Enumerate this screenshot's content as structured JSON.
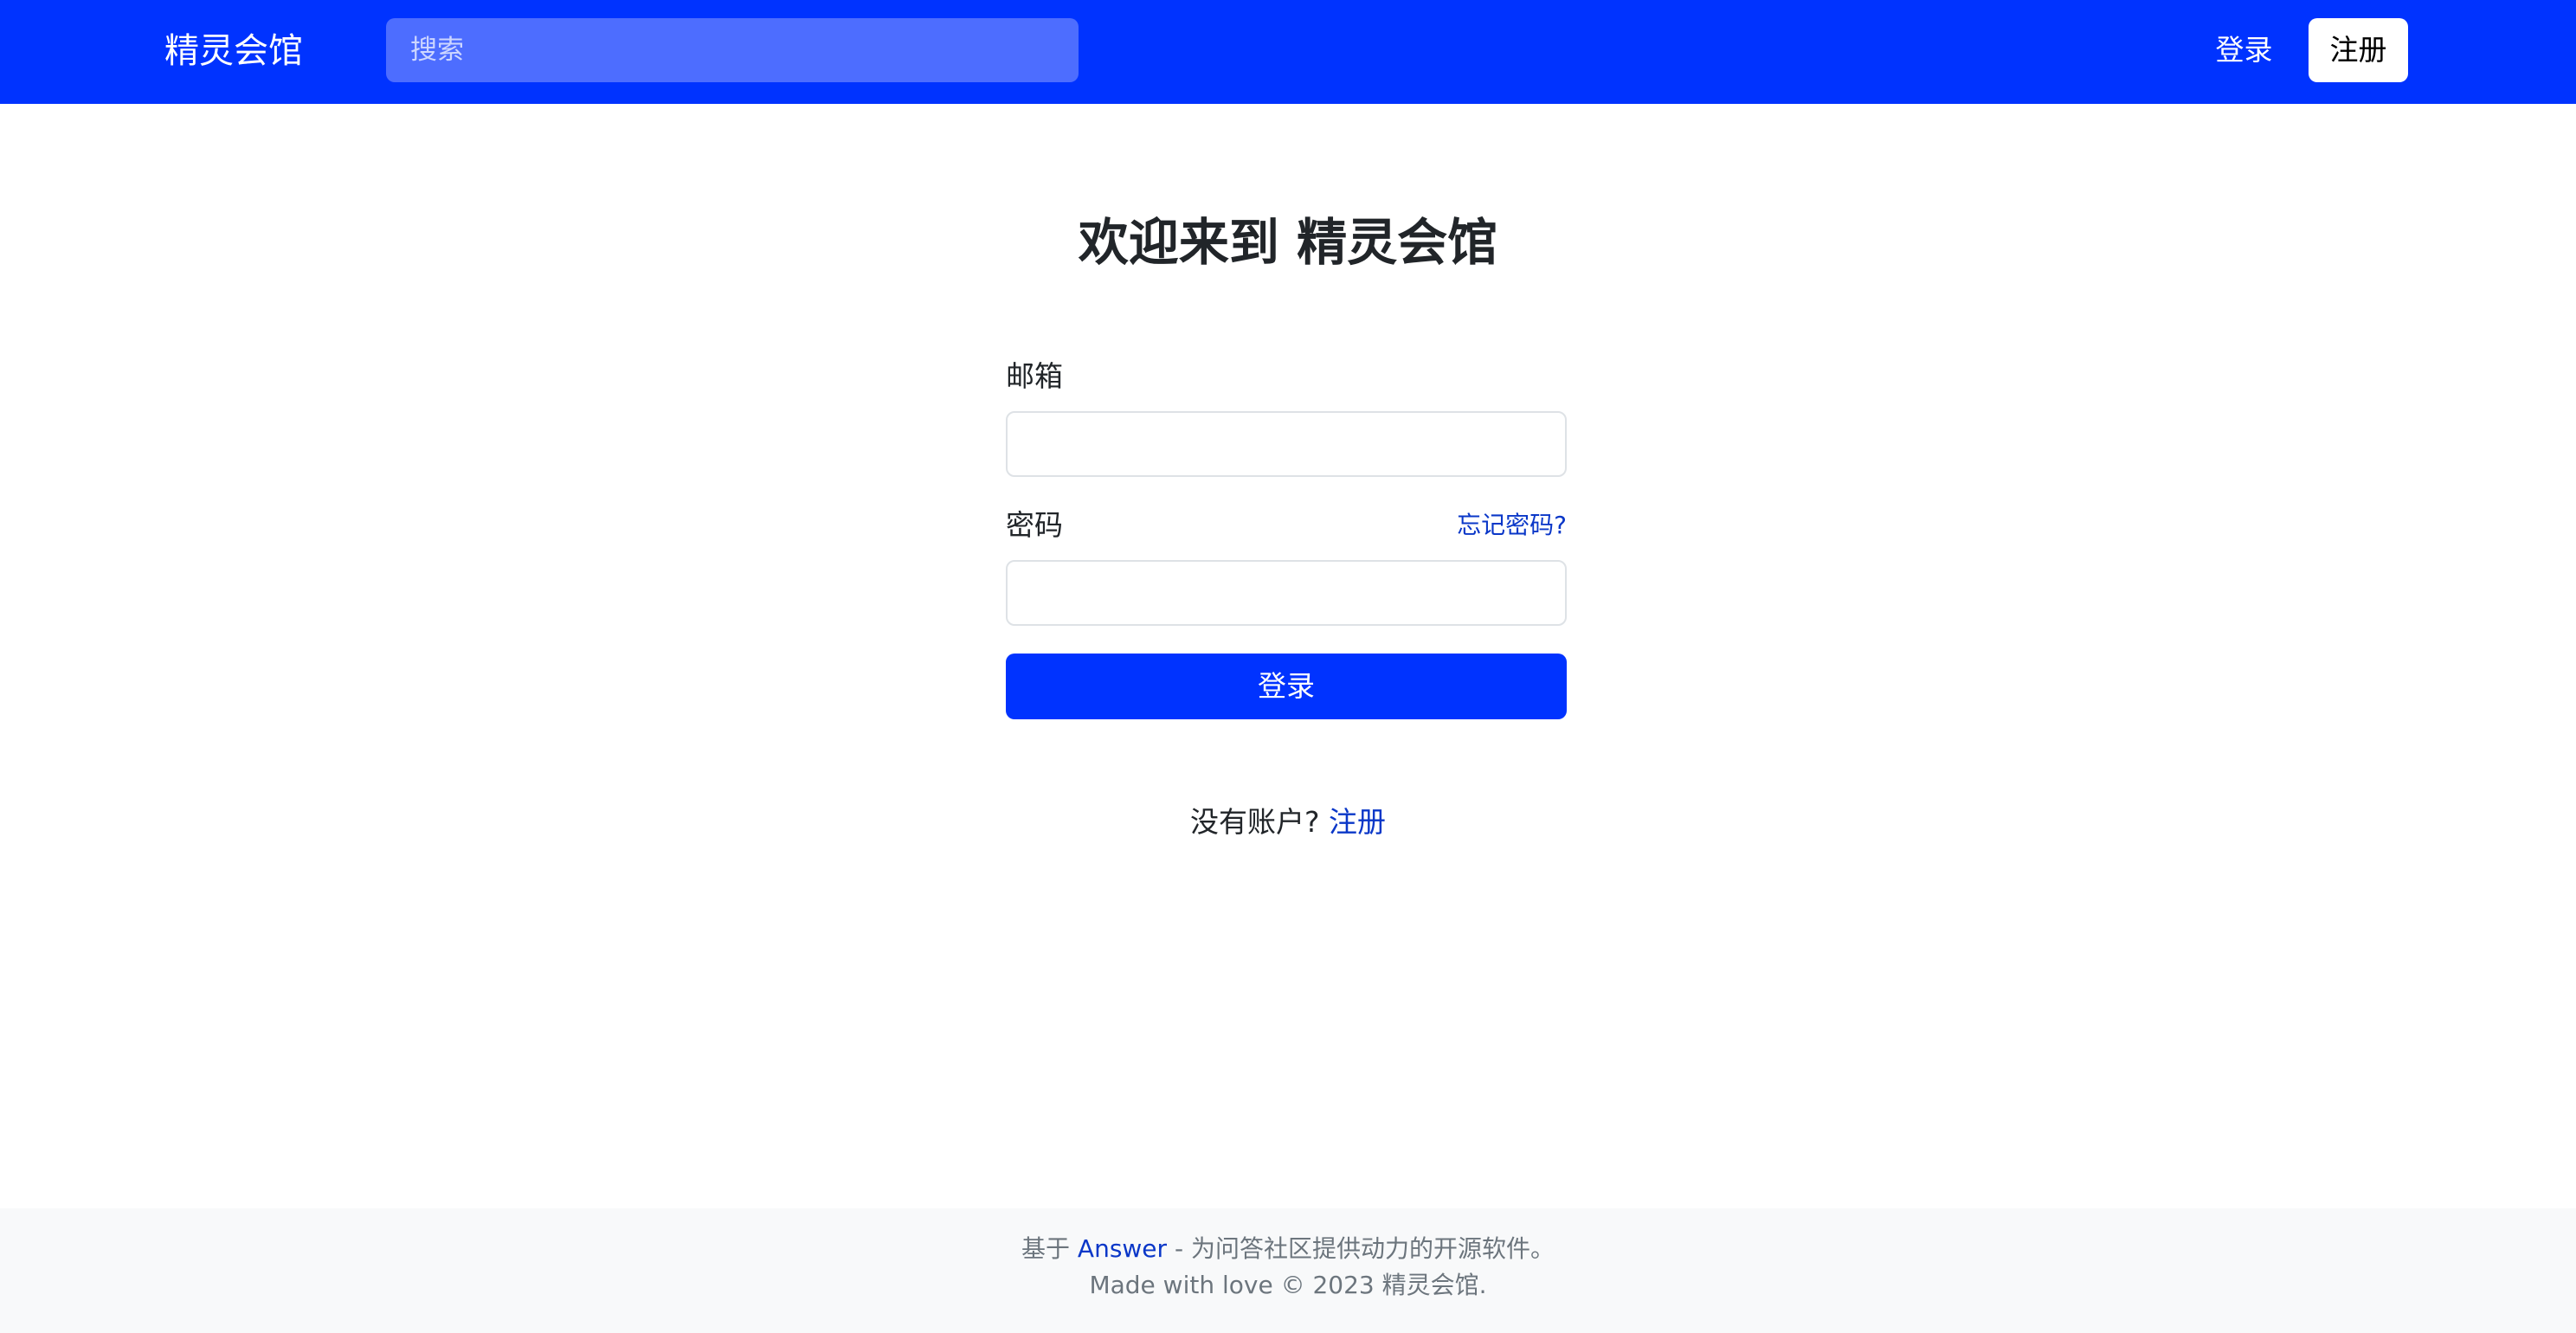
{
  "header": {
    "brand": "精灵会馆",
    "search_placeholder": "搜索",
    "login_label": "登录",
    "signup_label": "注册"
  },
  "main": {
    "title": "欢迎来到 精灵会馆",
    "email_label": "邮箱",
    "password_label": "密码",
    "forgot_label": "忘记密码?",
    "submit_label": "登录",
    "no_account_text": "没有账户?",
    "signup_link": "注册"
  },
  "footer": {
    "prefix": "基于",
    "answer_link": "Answer",
    "suffix": "- 为问答社区提供动力的开源软件。",
    "line2": "Made with love © 2023 精灵会馆."
  },
  "colors": {
    "brand_blue": "#0033ff",
    "link_blue": "#0a37c8",
    "search_bg": "#4d6dff",
    "footer_bg": "#f8f9fa"
  }
}
